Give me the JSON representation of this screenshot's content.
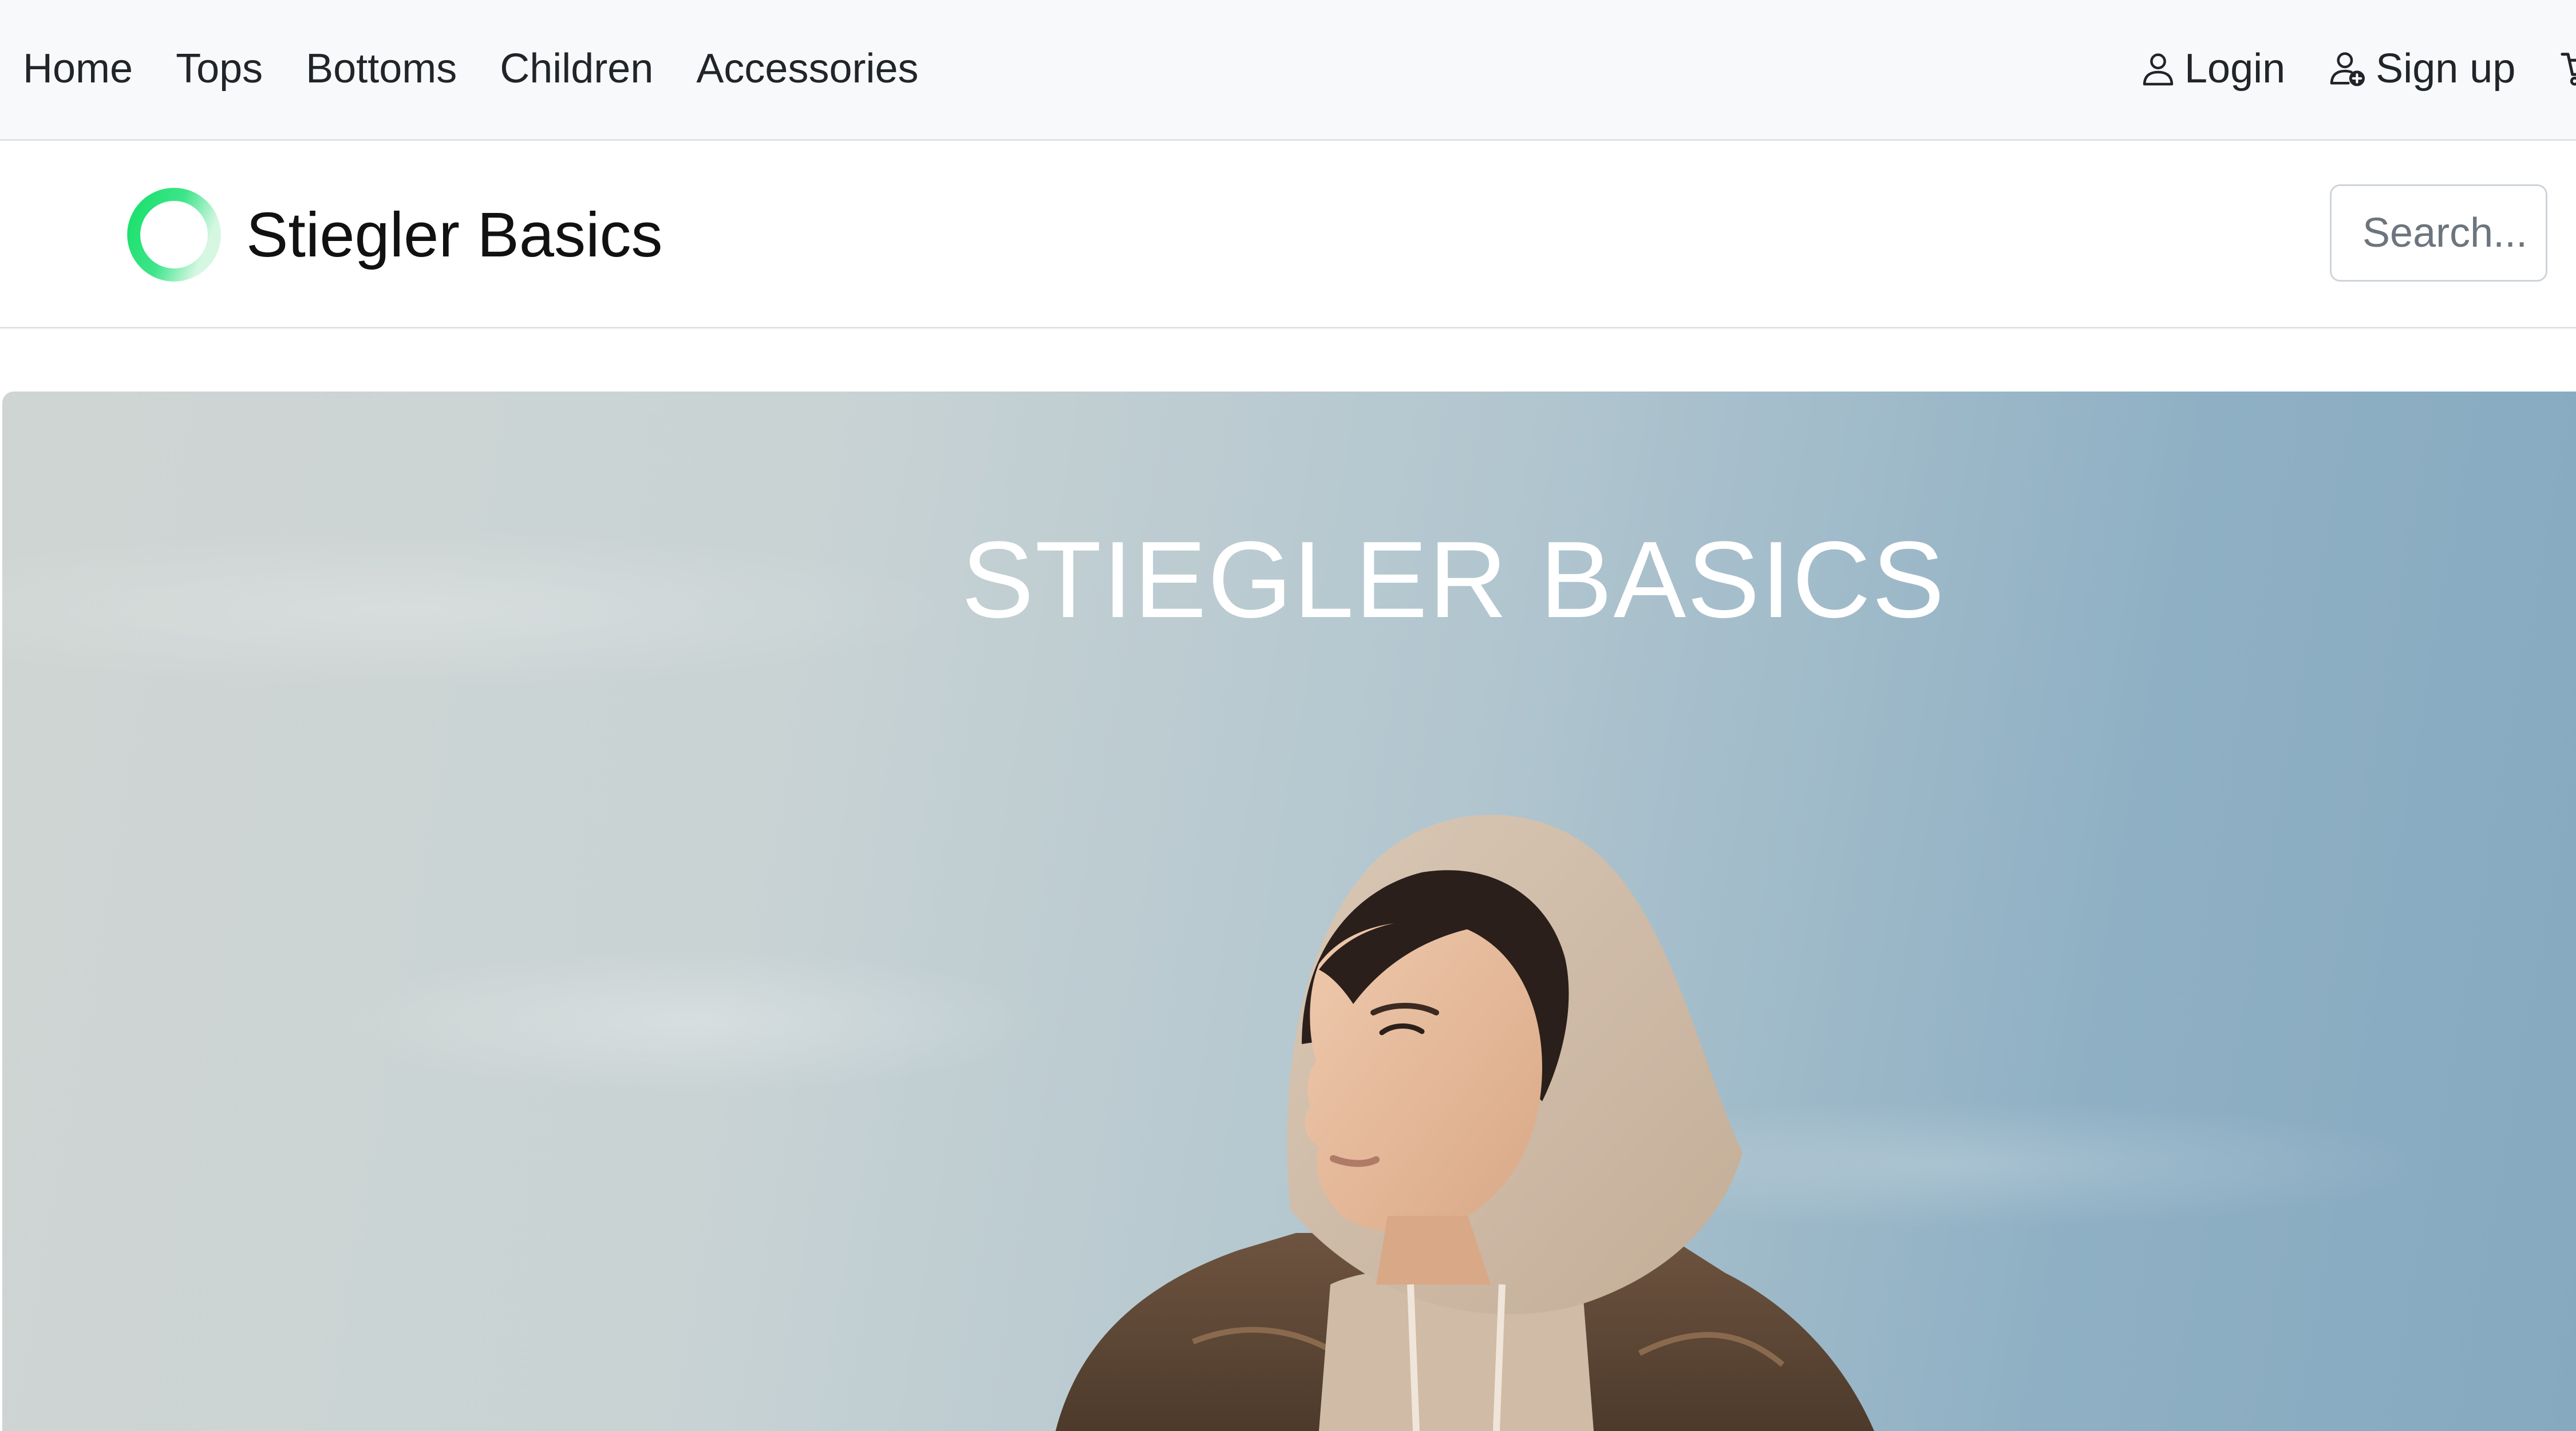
{
  "topnav": {
    "links": [
      "Home",
      "Tops",
      "Bottoms",
      "Children",
      "Accessories"
    ],
    "login_label": "Login",
    "signup_label": "Sign up"
  },
  "brand": {
    "name": "Stiegler Basics",
    "logo_colors": [
      "#1fe36b",
      "#bff5d2"
    ]
  },
  "search": {
    "placeholder": "Search..."
  },
  "hero": {
    "title": "STIEGLER BASICS",
    "image_subject": "woman-in-hoodie"
  },
  "icons": {
    "login": "user-icon",
    "signup": "user-plus-icon",
    "cart": "cart-icon"
  }
}
